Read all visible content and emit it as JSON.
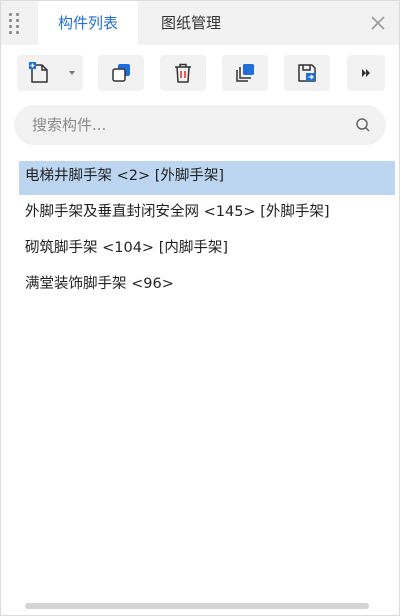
{
  "tabs": [
    {
      "label": "构件列表",
      "active": true
    },
    {
      "label": "图纸管理",
      "active": false
    }
  ],
  "toolbar": {
    "buttons": [
      {
        "icon": "new-document-icon"
      },
      {
        "icon": "copy-icon"
      },
      {
        "icon": "delete-icon"
      },
      {
        "icon": "copy-to-layer-icon"
      },
      {
        "icon": "save-as-icon"
      },
      {
        "icon": "more-icon"
      }
    ]
  },
  "search": {
    "placeholder": "搜索构件..."
  },
  "items": [
    {
      "name": "电梯井脚手架",
      "count": "<2>",
      "category": "[外脚手架]",
      "selected": true
    },
    {
      "name": "外脚手架及垂直封闭安全网",
      "count": "<145>",
      "category": "[外脚手架]",
      "selected": false
    },
    {
      "name": "砌筑脚手架",
      "count": "<104>",
      "category": "[内脚手架]",
      "selected": false
    },
    {
      "name": "满堂装饰脚手架",
      "count": "<96>",
      "category": "",
      "selected": false
    }
  ],
  "colors": {
    "accent": "#1e6fd9",
    "selection": "#bcd6f2",
    "toolbar_bg": "#f2f2f2"
  }
}
